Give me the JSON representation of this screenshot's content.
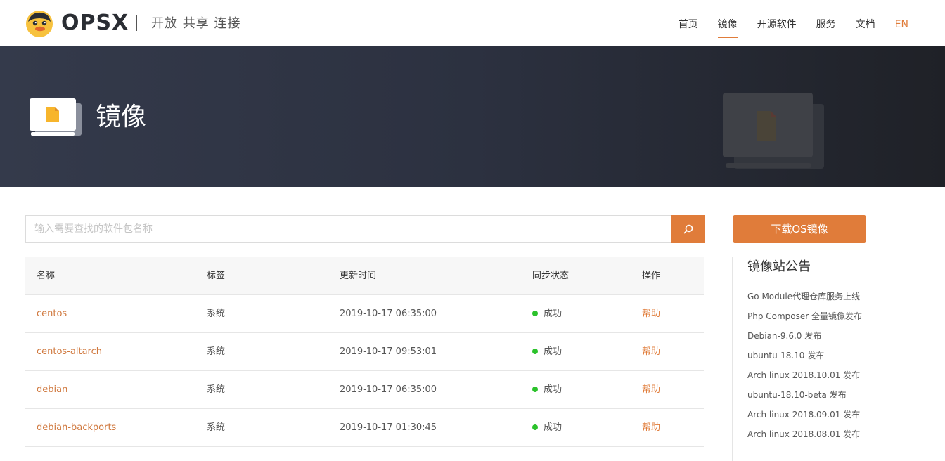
{
  "header": {
    "brand": "OPSX",
    "tagline": "开放 共享 连接",
    "nav": [
      {
        "label": "首页"
      },
      {
        "label": "镜像"
      },
      {
        "label": "开源软件"
      },
      {
        "label": "服务"
      },
      {
        "label": "文档"
      },
      {
        "label": "EN"
      }
    ],
    "active_nav": "镜像"
  },
  "banner": {
    "title": "镜像"
  },
  "search": {
    "placeholder": "输入需要查找的软件包名称",
    "value": ""
  },
  "table": {
    "headers": [
      "名称",
      "标签",
      "更新时间",
      "同步状态",
      "操作"
    ],
    "rows": [
      {
        "name": "centos",
        "tag": "系统",
        "updated": "2019-10-17 06:35:00",
        "status": "成功",
        "action": "帮助"
      },
      {
        "name": "centos-altarch",
        "tag": "系统",
        "updated": "2019-10-17 09:53:01",
        "status": "成功",
        "action": "帮助"
      },
      {
        "name": "debian",
        "tag": "系统",
        "updated": "2019-10-17 06:35:00",
        "status": "成功",
        "action": "帮助"
      },
      {
        "name": "debian-backports",
        "tag": "系统",
        "updated": "2019-10-17 01:30:45",
        "status": "成功",
        "action": "帮助"
      }
    ]
  },
  "sidebar": {
    "download_label": "下载OS镜像",
    "notice_title": "镜像站公告",
    "notices": [
      "Go Module代理仓库服务上线",
      "Php Composer 全量镜像发布",
      "Debian-9.6.0 发布",
      "ubuntu-18.10 发布",
      "Arch linux 2018.10.01 发布",
      "ubuntu-18.10-beta 发布",
      "Arch linux 2018.09.01 发布",
      "Arch linux 2018.08.01 发布"
    ]
  },
  "colors": {
    "accent": "#e07c3a",
    "link": "#d0793f",
    "success": "#2bc22b",
    "banner_dark": "#2c3140"
  },
  "icons": {
    "logo": "opsx-duck-logo",
    "banner": "document-monitor-icon",
    "search": "search-icon",
    "status": "status-dot-icon"
  }
}
